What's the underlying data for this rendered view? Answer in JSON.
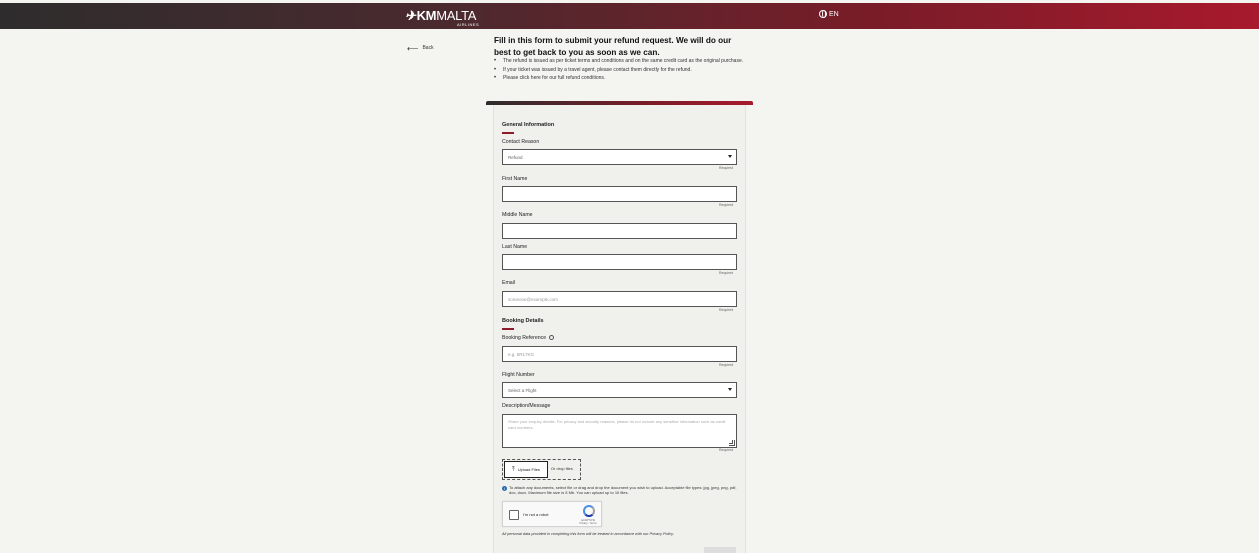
{
  "header": {
    "logo_text_bold": "KM",
    "logo_text_thin": "MALTA",
    "logo_sub": "AIRLINES",
    "lang_code": "EN"
  },
  "nav": {
    "back_label": "Back"
  },
  "intro": {
    "title": "Fill in this form to submit your refund request. We will do our best to get back to you as soon as we can.",
    "bullets": [
      "The refund is issued as per ticket terms and conditions and on the same credit card as the original purchase.",
      "If your ticket was issued by a travel agent, please contact them directly for the refund.",
      "Please click here for our full refund conditions."
    ]
  },
  "form": {
    "general_title": "General Information",
    "contact_reason": {
      "label": "Contact Reason",
      "value": "Refund",
      "required": "Required"
    },
    "first_name": {
      "label": "First Name",
      "value": "",
      "required": "Required"
    },
    "middle_name": {
      "label": "Middle Name",
      "value": ""
    },
    "last_name": {
      "label": "Last Name",
      "value": "",
      "required": "Required"
    },
    "email": {
      "label": "Email",
      "placeholder": "someone@example.com",
      "required": "Required"
    },
    "booking_title": "Booking Details",
    "booking_reference": {
      "label": "Booking Reference",
      "placeholder": "e.g. 5R17KG",
      "required": "Required"
    },
    "flight_number": {
      "label": "Flight Number",
      "value": "Select a Flight"
    },
    "description": {
      "label": "Description/Message",
      "placeholder": "Share your enquiry details. For privacy and security reasons, please do not include any sensitive information such as credit card numbers.",
      "required": "Required"
    },
    "upload_label": "Upload Files",
    "drop_label": "Or drop files",
    "attach_info": "To attach any documents, select file or drag and drop the document you wish to upload. Acceptable file types: jpg, jpeg, png, pdf, doc, docx. Maximum file size is 5 Mb. You can upload up to 10 files.",
    "captcha_label": "I'm not a robot",
    "captcha_brand": "reCAPTCHA",
    "captcha_links": "Privacy - Terms",
    "privacy_note": "All personal data provided in completing this form will be treated in accordance with our Privacy Policy."
  },
  "colors": {
    "accent": "#8e1b2b",
    "header_dark": "#2e2c2d",
    "header_red": "#a81a2d"
  }
}
